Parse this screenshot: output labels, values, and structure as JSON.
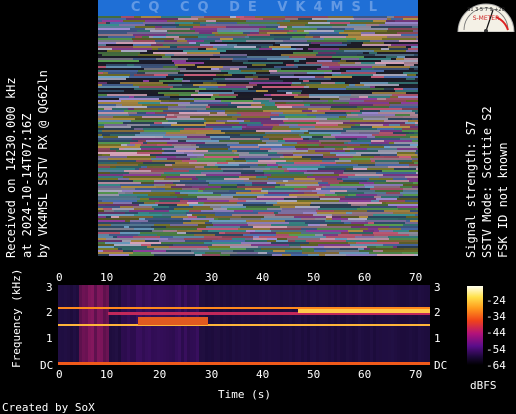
{
  "sstv": {
    "received_line": "Received on  14230.000 kHz",
    "time_line": "at 2024-10-14T07:16Z",
    "by_line": "by VK4MSL SSTV RX @ QG62ln",
    "signal_line": "Signal strength: S7",
    "mode_line": "SSTV Mode: Scottie S2",
    "fsk_line": "FSK ID not known",
    "decoded_image_text": "CQ CQ DE VK4MSL"
  },
  "meter": {
    "scale_text": "S1 3 5 7 9 +20",
    "label": "S-METER",
    "reading": "S7"
  },
  "spectrogram": {
    "x_ticks": [
      "0",
      "10",
      "20",
      "30",
      "40",
      "50",
      "60",
      "70"
    ],
    "y_ticks": [
      "3",
      "2",
      "1",
      "DC"
    ],
    "xlabel": "Time (s)",
    "ylabel": "Frequency (kHz)",
    "colorbar_ticks": [
      "-24",
      "-34",
      "-44",
      "-54",
      "-64"
    ],
    "colorbar_unit": "dBFS",
    "credit": "Created by SoX"
  },
  "colors": {
    "background": "#000000",
    "sky": "#1f6fd6",
    "spectro_bg": "#150730",
    "tone_hot": "#ff9b1c",
    "dc_line": "#f05a1a"
  }
}
